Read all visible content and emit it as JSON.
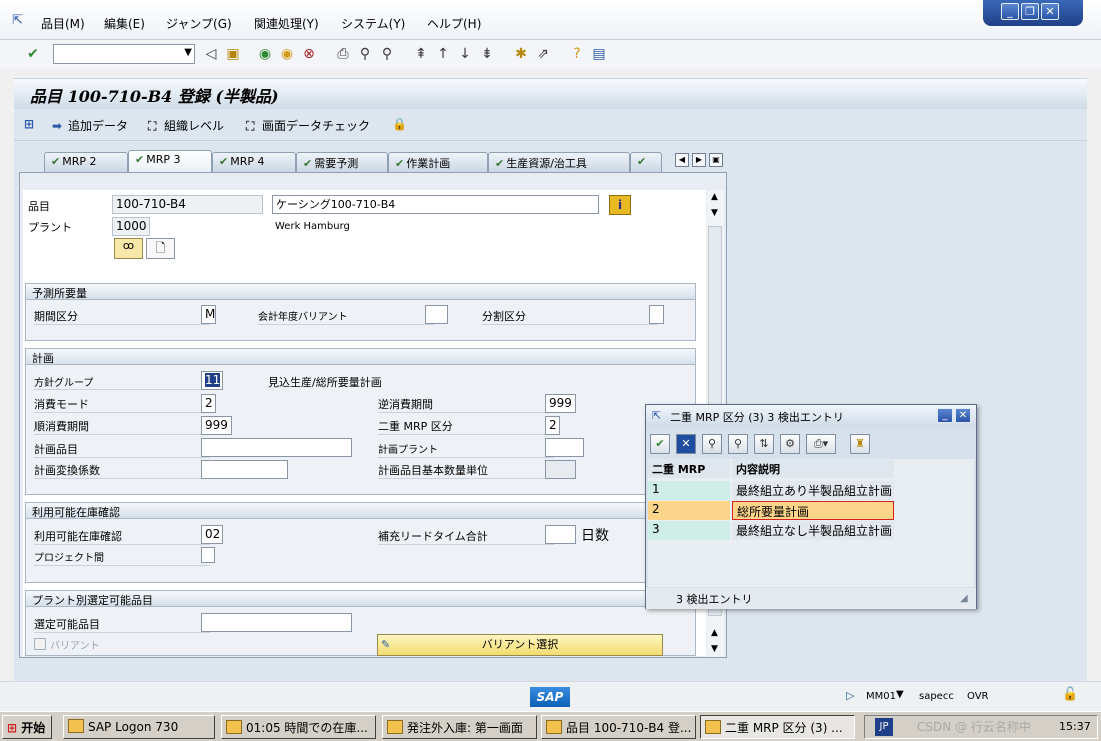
{
  "menu": {
    "items": [
      "品目(M)",
      "編集(E)",
      "ジャンプ(G)",
      "関連処理(Y)",
      "システム(Y)",
      "ヘルプ(H)"
    ]
  },
  "window_controls": {
    "minimize": "_",
    "restore": "❐",
    "close": "✕"
  },
  "page": {
    "title": "品目 100-710-B4 登録 (半製品)"
  },
  "app_toolbar": {
    "add_data": "追加データ",
    "org_levels": "組織レベル",
    "check_screen_data": "画面データチェック"
  },
  "tabs": [
    "MRP 2",
    "MRP 3",
    "MRP 4",
    "需要予測",
    "作業計画",
    "生産資源/治工具"
  ],
  "active_tab": "MRP 3",
  "header": {
    "material_label": "品目",
    "material_value": "100-710-B4",
    "material_desc": "ケーシング100-710-B4",
    "plant_label": "プラント",
    "plant_value": "1000",
    "plant_name": "Werk Hamburg"
  },
  "group_forecast": {
    "title": "予測所要量",
    "period_label": "期間区分",
    "period_value": "M",
    "fiscal_variant_label": "会計年度バリアント",
    "fiscal_variant_value": "",
    "split_label": "分割区分",
    "split_value": ""
  },
  "group_planning": {
    "title": "計画",
    "strategy_group_label": "方針グループ",
    "strategy_group_value": "11",
    "strategy_group_desc": "見込生産/総所要量計画",
    "consumption_mode_label": "消費モード",
    "consumption_mode_value": "2",
    "backward_period_label": "逆消費期間",
    "backward_period_value": "999",
    "forward_period_label": "順消費期間",
    "forward_period_value": "999",
    "mixed_mrp_label": "二重 MRP 区分",
    "mixed_mrp_value": "2",
    "planning_material_label": "計画品目",
    "planning_material_value": "",
    "planning_plant_label": "計画プラント",
    "planning_plant_value": "",
    "conv_factor_label": "計画変換係数",
    "conv_factor_value": "",
    "base_uom_label": "計画品目基本数量単位",
    "base_uom_value": ""
  },
  "group_availability": {
    "title": "利用可能在庫確認",
    "avail_check_label": "利用可能在庫確認",
    "avail_check_value": "02",
    "total_lead_label": "補充リードタイム合計",
    "total_lead_value": "",
    "days_unit": "日数",
    "cross_project_label": "プロジェクト間",
    "cross_project_value": ""
  },
  "group_plant_select": {
    "title": "プラント別選定可能品目",
    "selectable_label": "選定可能品目",
    "selectable_value": "",
    "variant_label": "バリアント",
    "variant_select_button": "バリアント選択"
  },
  "popup": {
    "title": "二重 MRP 区分 (3)   3 検出エントリ",
    "col_key": "二重 MRP",
    "col_desc": "内容説明",
    "rows": [
      {
        "key": "1",
        "desc": "最終組立あり半製品組立計画"
      },
      {
        "key": "2",
        "desc": "総所要量計画"
      },
      {
        "key": "3",
        "desc": "最終組立なし半製品組立計画"
      }
    ],
    "selected_row": 1,
    "status": "3 検出エントリ"
  },
  "statusbar": {
    "transaction": "MM01",
    "server": "sapecc",
    "mode": "OVR",
    "logo": "SAP"
  },
  "taskbar": {
    "start": "开始",
    "tasks": [
      "SAP Logon 730",
      "01:05 時間での在庫...",
      "発注外入庫: 第一画面",
      "品目 100-710-B4 登...",
      "二重 MRP 区分 (3) ..."
    ],
    "lang": "JP",
    "clock": "15:37",
    "watermark": "CSDN @ 行云名称中"
  },
  "colors": {
    "accent": "#1f3f86",
    "selected_row": "#fcd58a",
    "key_cell": "#cfeee8",
    "sap_blue": "#0a6ed1"
  }
}
